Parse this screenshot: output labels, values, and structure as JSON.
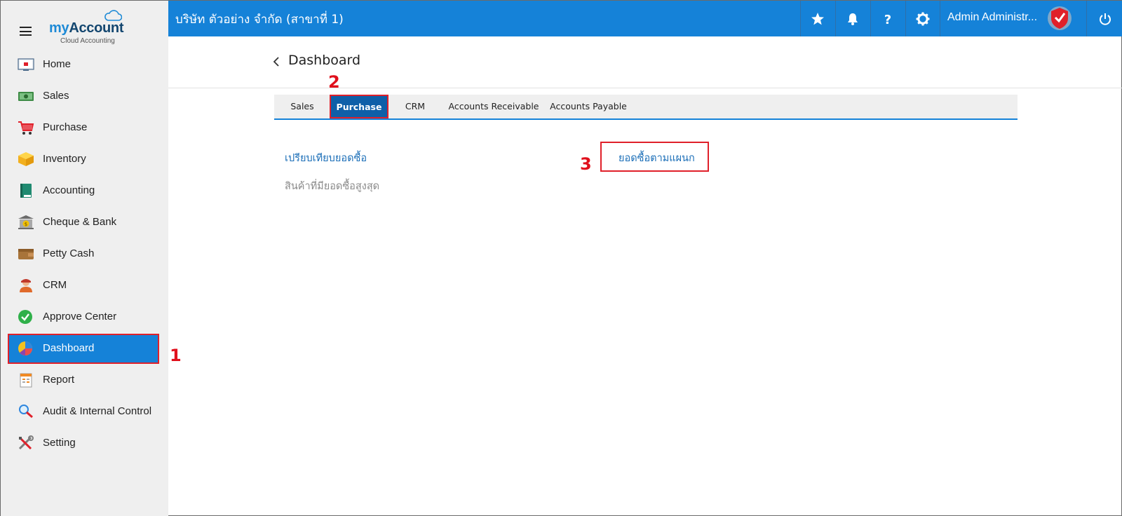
{
  "app": {
    "logo_my": "my",
    "logo_account": "Account",
    "logo_subtitle": "Cloud Accounting"
  },
  "sidebar": {
    "items": [
      {
        "label": "Home",
        "icon": "home-icon"
      },
      {
        "label": "Sales",
        "icon": "sales-icon"
      },
      {
        "label": "Purchase",
        "icon": "cart-icon"
      },
      {
        "label": "Inventory",
        "icon": "box-icon"
      },
      {
        "label": "Accounting",
        "icon": "ledger-book-icon"
      },
      {
        "label": "Cheque & Bank",
        "icon": "bank-icon"
      },
      {
        "label": "Petty Cash",
        "icon": "wallet-icon"
      },
      {
        "label": "CRM",
        "icon": "person-icon"
      },
      {
        "label": "Approve Center",
        "icon": "check-circle-icon"
      },
      {
        "label": "Dashboard",
        "icon": "pie-chart-icon",
        "active": true
      },
      {
        "label": "Report",
        "icon": "report-icon"
      },
      {
        "label": "Audit & Internal Control",
        "icon": "magnifier-icon"
      },
      {
        "label": "Setting",
        "icon": "tools-icon"
      }
    ]
  },
  "header": {
    "company": "บริษัท ตัวอย่าง จำกัด (สาขาที่ 1)",
    "user_name": "Admin Administr...",
    "icons": [
      "star-icon",
      "bell-icon",
      "help-icon",
      "gear-icon",
      "power-icon"
    ]
  },
  "page": {
    "title": "Dashboard"
  },
  "tabs": [
    {
      "label": "Sales"
    },
    {
      "label": "Purchase",
      "active": true
    },
    {
      "label": "CRM"
    },
    {
      "label": "Accounts Receivable"
    },
    {
      "label": "Accounts Payable"
    }
  ],
  "content": {
    "link_compare": "เปรียบเทียบยอดซื้อ",
    "link_top_items": "สินค้าที่มียอดซื้อสูงสุด",
    "link_by_department": "ยอดซื้อตามแผนก"
  },
  "annotations": {
    "step1": "1",
    "step2": "2",
    "step3": "3"
  },
  "colors": {
    "primary": "#1582d8",
    "active_tab": "#0f5fa8",
    "highlight": "#e0202a",
    "sidebar_bg": "#efefef"
  }
}
